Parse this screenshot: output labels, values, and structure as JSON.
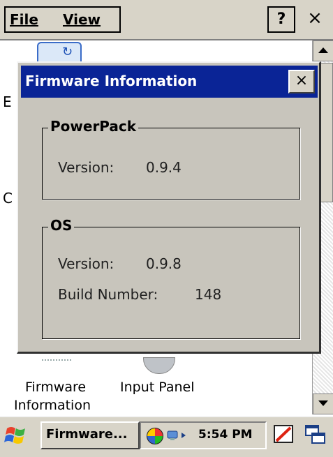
{
  "menubar": {
    "file_label": "File",
    "view_label": "View",
    "help_label": "?",
    "close_label": "×"
  },
  "background": {
    "stub_top": "E",
    "stub_mid": "C",
    "label_firmware_line1": "Firmware",
    "label_firmware_line2": "Information",
    "label_input_panel": "Input Panel"
  },
  "dialog": {
    "title": "Firmware Information",
    "close_label": "×",
    "powerpack": {
      "legend": "PowerPack",
      "version_label": "Version:",
      "version_value": "0.9.4"
    },
    "os": {
      "legend": "OS",
      "version_label": "Version:",
      "version_value": "0.9.8",
      "build_label": "Build Number:",
      "build_value": "148"
    }
  },
  "taskbar": {
    "task_button_label": "Firmware...",
    "clock": "5:54 PM",
    "icons": [
      "start-flag-icon",
      "globe-icon",
      "network-icon",
      "pen-input-icon",
      "windows-switch-icon"
    ]
  },
  "colors": {
    "titlebar": "#0a2496",
    "dialog_face": "#c8c5bc",
    "chrome": "#d8d4c8"
  }
}
